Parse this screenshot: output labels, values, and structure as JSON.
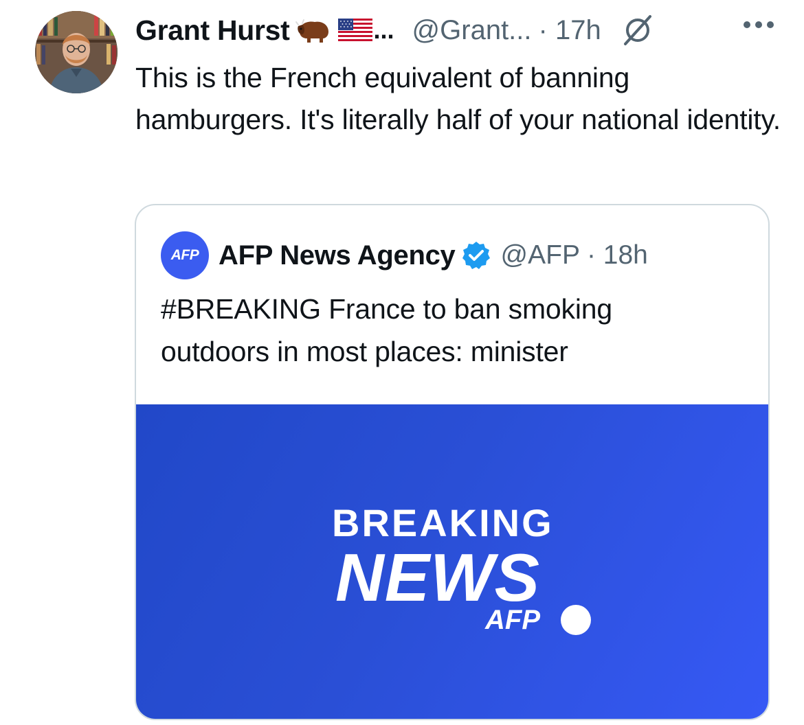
{
  "tweet": {
    "display_name": "Grant Hurst",
    "name_ellipsis": "...",
    "handle": "@Grant...",
    "time": "· 17h",
    "text": "This is the French equivalent of banning hamburgers. It's literally half of your national identity.",
    "icons": [
      "bison-emoji",
      "us-flag-emoji",
      "grok-icon",
      "more-icon"
    ]
  },
  "quote": {
    "logo_text": "AFP",
    "display_name": "AFP News Agency",
    "handle": "@AFP",
    "time": "· 18h",
    "text": "#BREAKING France to ban smoking outdoors in most places: minister",
    "media": {
      "line1": "BREAKING",
      "line2": "NEWS",
      "brand": "AFP",
      "background_color": "#2d50dc"
    }
  },
  "colors": {
    "text": "#0f1419",
    "secondary": "#536471",
    "border": "#cfd9de",
    "verified": "#1d9bf0",
    "afp_blue": "#3b5cf0"
  }
}
